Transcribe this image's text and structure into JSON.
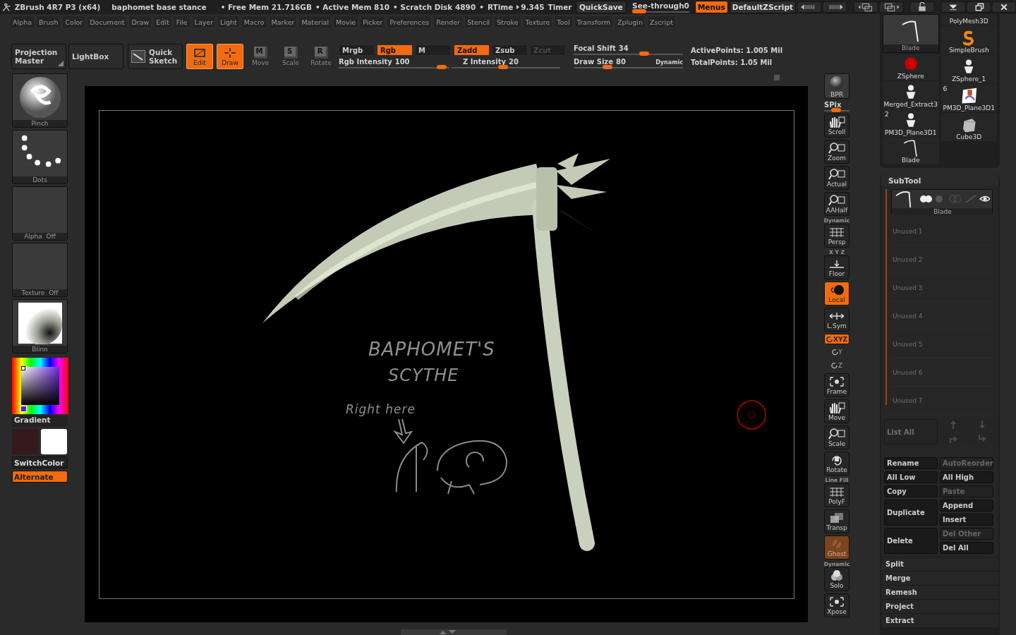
{
  "title_bar": {
    "app_name": "ZBrush 4R7 P3 (x64)",
    "document": "baphomet base stance",
    "stats": [
      "• Free Mem 21.716GB",
      "• Active Mem 810",
      "• Scratch Disk 4890",
      "•"
    ],
    "rtime_label": "RTime",
    "rtime_value": "9.345",
    "timer": "Timer",
    "quicksave": "QuickSave",
    "see_through": {
      "label": "See-through",
      "value": "0",
      "level": 0
    },
    "menus_button": {
      "label": "Menus",
      "on": true
    },
    "zscript": "DefaultZScript"
  },
  "menu_bar": [
    "Alpha",
    "Brush",
    "Color",
    "Document",
    "Draw",
    "Edit",
    "File",
    "Layer",
    "Light",
    "Macro",
    "Marker",
    "Material",
    "Movie",
    "Picker",
    "Preferences",
    "Render",
    "Stencil",
    "Stroke",
    "Texture",
    "Tool",
    "Transform",
    "Zplugin",
    "Zscript"
  ],
  "toolbar": {
    "large_buttons": [
      {
        "label": "Projection Master",
        "kind": "corner"
      },
      {
        "label": "LightBox",
        "kind": "plain"
      },
      {
        "label": "Quick Sketch",
        "kind": "sketch"
      }
    ],
    "mode_buttons": [
      {
        "label": "Edit",
        "kind": "edit",
        "on": true
      },
      {
        "label": "Draw",
        "kind": "draw",
        "on": true
      },
      {
        "label": "Move",
        "kind": "letter",
        "glyph": "M",
        "on": false
      },
      {
        "label": "Scale",
        "kind": "letter",
        "glyph": "S",
        "on": false
      },
      {
        "label": "Rotate",
        "kind": "letter",
        "glyph": "R",
        "on": false
      }
    ],
    "channel_buttons": [
      {
        "label": "Mrgb",
        "on": false,
        "disabled": false
      },
      {
        "label": "Rgb",
        "on": true,
        "disabled": false
      },
      {
        "label": "M",
        "on": false,
        "disabled": false
      },
      {
        "label": "Zadd",
        "on": true,
        "disabled": false
      },
      {
        "label": "Zsub",
        "on": false,
        "disabled": false
      },
      {
        "label": "Zcut",
        "on": false,
        "disabled": true
      }
    ],
    "intensity_sliders": [
      {
        "label": "Rgb Intensity",
        "value": "100",
        "level": 0.97
      },
      {
        "label": "Z Intensity",
        "value": "20",
        "level": 0.47
      }
    ],
    "draw_sliders": [
      {
        "label": "Focal Shift",
        "value": "34",
        "level": 0.66
      },
      {
        "label": "Draw Size",
        "value": "80",
        "level": 0.29,
        "note": "Dynamic"
      }
    ],
    "stats": [
      "ActivePoints: 1.005 Mil",
      "TotalPoints: 1.05 Mil"
    ]
  },
  "left_shelf": {
    "tiles": [
      {
        "label": "Pinch",
        "kind": "brush"
      },
      {
        "label": "Dots",
        "kind": "dots"
      },
      {
        "label": "Alpha Off",
        "kind": "empty"
      },
      {
        "label": "Texture Off",
        "kind": "empty"
      },
      {
        "label": "Blinn",
        "kind": "material"
      }
    ],
    "gradient_label": "Gradient",
    "swatches": [
      {
        "color": "#361a1b"
      },
      {
        "color": "#ffffff"
      }
    ],
    "buttons": [
      {
        "label": "SwitchColor",
        "on": false
      },
      {
        "label": "Alternate",
        "on": true
      }
    ]
  },
  "viewport": {
    "sketch_texts": [
      "BAPHOMET'S",
      "SCYTHE",
      "Right here"
    ]
  },
  "right_shelf": [
    {
      "label": "BPR",
      "kind": "render"
    },
    {
      "label": "SPix",
      "kind": "slider",
      "level": 0.45
    },
    {
      "label": "Scroll",
      "kind": "hand",
      "on": false,
      "disabled": false
    },
    {
      "label": "Zoom",
      "kind": "magnifier",
      "on": false,
      "disabled": false
    },
    {
      "label": "Actual",
      "kind": "magnifier",
      "on": false,
      "disabled": false
    },
    {
      "label": "AAHalf",
      "kind": "magnifier",
      "on": false,
      "disabled": false
    },
    {
      "label": "Persp",
      "kind": "grid",
      "caption": "Dynamic",
      "on": false,
      "disabled": false
    },
    {
      "label": "Floor",
      "kind": "floor",
      "caption": "X Y Z",
      "on": false,
      "disabled": false
    },
    {
      "label": "Local",
      "kind": "sphere",
      "on": true,
      "disabled": false
    },
    {
      "label": "L.Sym",
      "kind": "arrows",
      "on": false,
      "disabled": false
    },
    {
      "label": "XYZ",
      "kind": "pill",
      "on": true
    },
    {
      "label": "Y",
      "kind": "mini"
    },
    {
      "label": "Z",
      "kind": "mini"
    },
    {
      "label": "Frame",
      "kind": "frame",
      "on": false,
      "disabled": false
    },
    {
      "label": "Move",
      "kind": "hand",
      "on": false,
      "disabled": false
    },
    {
      "label": "Scale",
      "kind": "magnifier",
      "on": false,
      "disabled": false
    },
    {
      "label": "Rotate",
      "kind": "rotate",
      "on": false,
      "disabled": false
    },
    {
      "label": "PolyF",
      "kind": "grid",
      "caption": "Line Fill",
      "on": false,
      "disabled": false
    },
    {
      "label": "Transp",
      "kind": "squares",
      "on": false,
      "disabled": false
    },
    {
      "label": "Ghost",
      "kind": "ghost",
      "on": true,
      "disabled": true
    },
    {
      "label": "Solo",
      "kind": "spheres",
      "caption": "Dynamic",
      "on": false,
      "disabled": false
    },
    {
      "label": "Xpose",
      "kind": "frame",
      "on": false,
      "disabled": false
    }
  ],
  "tool_tray": {
    "left": [
      {
        "label": "Blade",
        "kind": "blade",
        "selected": true
      },
      {
        "label": "ZSphere",
        "kind": "zsphere",
        "selected": false
      },
      {
        "label": "Merged_Extract3",
        "kind": "figure",
        "selected": false
      },
      {
        "label": "PM3D_Plane3D1",
        "kind": "figure",
        "badge": "2",
        "selected": false
      },
      {
        "label": "Blade",
        "kind": "blade",
        "selected": false
      }
    ],
    "right": [
      {
        "label": "PolyMesh3D",
        "kind": "cut",
        "selected": false
      },
      {
        "label": "SimpleBrush",
        "kind": "brush",
        "selected": false
      },
      {
        "label": "ZSphere_1",
        "kind": "figure",
        "selected": false
      },
      {
        "label": "PM3D_Plane3D1",
        "kind": "plane",
        "badge": "6",
        "selected": false
      },
      {
        "label": "Cube3D",
        "kind": "cube",
        "selected": false
      }
    ]
  },
  "subtool": {
    "title": "SubTool",
    "items": [
      {
        "label": "Blade",
        "kind": "mesh",
        "selected": true
      },
      {
        "label": "Unused 1",
        "kind": "empty",
        "selected": false
      },
      {
        "label": "Unused 2",
        "kind": "empty",
        "selected": false
      },
      {
        "label": "Unused 3",
        "kind": "empty",
        "selected": false
      },
      {
        "label": "Unused 4",
        "kind": "empty",
        "selected": false
      },
      {
        "label": "Unused 5",
        "kind": "empty",
        "selected": false
      },
      {
        "label": "Unused 6",
        "kind": "empty",
        "selected": false
      },
      {
        "label": "Unused 7",
        "kind": "empty",
        "selected": false
      }
    ],
    "list_all": {
      "label": "List All",
      "disabled": true
    },
    "actions_left": [
      {
        "label": "Rename",
        "disabled": false,
        "tall": false
      },
      {
        "label": "All Low",
        "disabled": false,
        "tall": false
      },
      {
        "label": "Copy",
        "disabled": false,
        "tall": false
      },
      {
        "label": "Duplicate",
        "disabled": false,
        "tall": true
      },
      {
        "label": "Delete",
        "disabled": false,
        "tall": true
      }
    ],
    "actions_right": [
      {
        "label": "AutoReorder",
        "disabled": true,
        "tall": false
      },
      {
        "label": "All High",
        "disabled": false,
        "tall": false
      },
      {
        "label": "Paste",
        "disabled": true,
        "tall": false
      },
      {
        "label": "Append",
        "disabled": false,
        "tall": false
      },
      {
        "label": "Insert",
        "disabled": false,
        "tall": false
      },
      {
        "label": "Del Other",
        "disabled": true,
        "tall": false
      },
      {
        "label": "Del All",
        "disabled": false,
        "tall": false
      }
    ],
    "sections": [
      "Split",
      "Merge",
      "Remesh",
      "Project",
      "Extract"
    ]
  }
}
